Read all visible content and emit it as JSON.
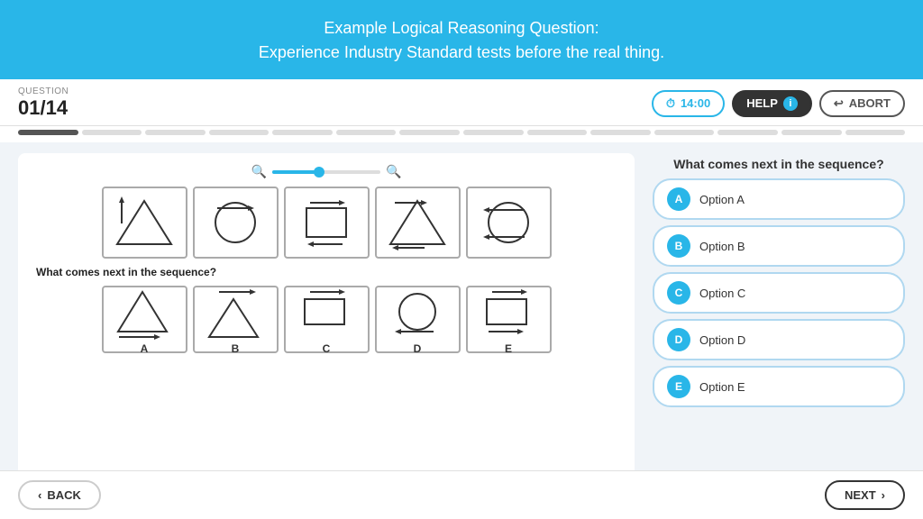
{
  "header": {
    "line1": "Example Logical Reasoning Question:",
    "line2": "Experience Industry Standard tests before the real thing."
  },
  "question_bar": {
    "label": "QUESTION",
    "number": "01/14",
    "timer": "14:00",
    "help_label": "HELP",
    "abort_label": "ABORT"
  },
  "progress": {
    "total": 14,
    "done": 1
  },
  "main": {
    "right_question": "What comes next in the sequence?",
    "left_question": "What comes next in the sequence?",
    "options": [
      {
        "id": "A",
        "label": "Option A"
      },
      {
        "id": "B",
        "label": "Option B"
      },
      {
        "id": "C",
        "label": "Option C"
      },
      {
        "id": "D",
        "label": "Option D"
      },
      {
        "id": "E",
        "label": "Option E"
      }
    ],
    "answer_labels": [
      "A",
      "B",
      "C",
      "D",
      "E"
    ]
  },
  "footer": {
    "back_label": "BACK",
    "next_label": "NEXT"
  }
}
